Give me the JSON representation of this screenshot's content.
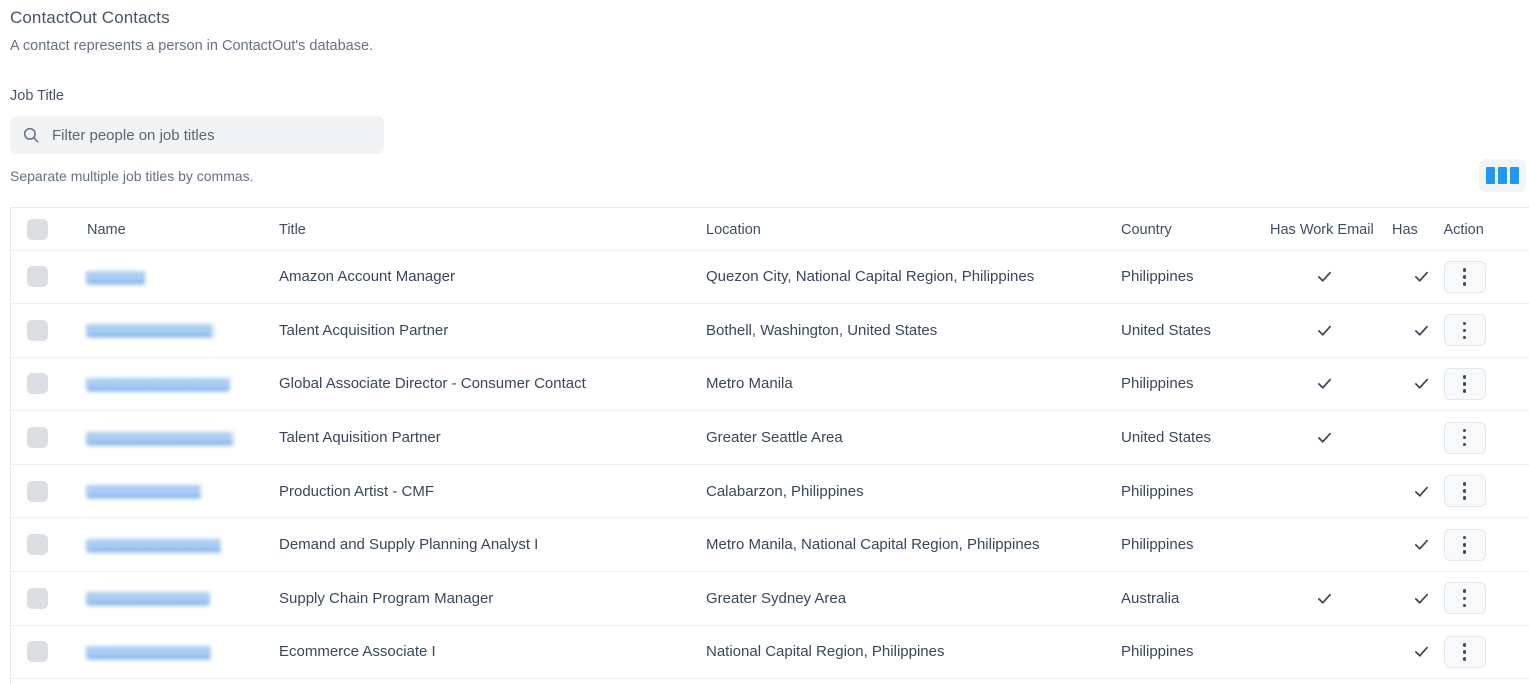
{
  "header": {
    "title": "ContactOut Contacts",
    "subtitle": "A contact represents a person in ContactOut's database."
  },
  "filter": {
    "label": "Job Title",
    "search_placeholder": "Filter people on job titles",
    "search_value": "",
    "hint": "Separate multiple job titles by commas.",
    "search_icon": "search-icon"
  },
  "toolbar": {
    "column_picker_icon": "columns-icon",
    "accent_color": "#2196f3"
  },
  "table": {
    "columns": [
      {
        "key": "select",
        "label": ""
      },
      {
        "key": "name",
        "label": "Name"
      },
      {
        "key": "title",
        "label": "Title"
      },
      {
        "key": "location",
        "label": "Location"
      },
      {
        "key": "country",
        "label": "Country"
      },
      {
        "key": "work",
        "label": "Has Work Email"
      },
      {
        "key": "personal",
        "label": "Has "
      },
      {
        "key": "action",
        "label": "Action"
      }
    ],
    "rows": [
      {
        "name": "",
        "name_redacted": true,
        "name_width": 58,
        "title": "Amazon Account Manager",
        "location": "Quezon City, National Capital Region, Philippines",
        "country": "Philippines",
        "has_work_email": true,
        "has_personal_email": true,
        "action_icon": "kebab-menu-icon"
      },
      {
        "name": "",
        "name_redacted": true,
        "name_width": 126,
        "title": "Talent Acquisition Partner",
        "location": "Bothell, Washington, United States",
        "country": "United States",
        "has_work_email": true,
        "has_personal_email": true,
        "action_icon": "kebab-menu-icon"
      },
      {
        "name": "",
        "name_redacted": true,
        "name_width": 142,
        "title": "Global Associate Director - Consumer Contact",
        "location": "Metro Manila",
        "country": "Philippines",
        "has_work_email": true,
        "has_personal_email": true,
        "action_icon": "kebab-menu-icon"
      },
      {
        "name": "",
        "name_redacted": true,
        "name_width": 146,
        "title": "Talent Aquisition Partner",
        "location": "Greater Seattle Area",
        "country": "United States",
        "has_work_email": true,
        "has_personal_email": false,
        "action_icon": "kebab-menu-icon"
      },
      {
        "name": "",
        "name_redacted": true,
        "name_width": 114,
        "title": "Production Artist - CMF",
        "location": "Calabarzon, Philippines",
        "country": "Philippines",
        "has_work_email": false,
        "has_personal_email": true,
        "action_icon": "kebab-menu-icon"
      },
      {
        "name": "",
        "name_redacted": true,
        "name_width": 134,
        "title": "Demand and Supply Planning Analyst I",
        "location": "Metro Manila, National Capital Region, Philippines",
        "country": "Philippines",
        "has_work_email": false,
        "has_personal_email": true,
        "action_icon": "kebab-menu-icon"
      },
      {
        "name": "",
        "name_redacted": true,
        "name_width": 122,
        "title": "Supply Chain Program Manager",
        "location": "Greater Sydney Area",
        "country": "Australia",
        "has_work_email": true,
        "has_personal_email": true,
        "action_icon": "kebab-menu-icon"
      },
      {
        "name": "",
        "name_redacted": true,
        "name_width": 124,
        "title": "Ecommerce Associate I",
        "location": "National Capital Region, Philippines",
        "country": "Philippines",
        "has_work_email": false,
        "has_personal_email": true,
        "action_icon": "kebab-menu-icon"
      }
    ]
  }
}
